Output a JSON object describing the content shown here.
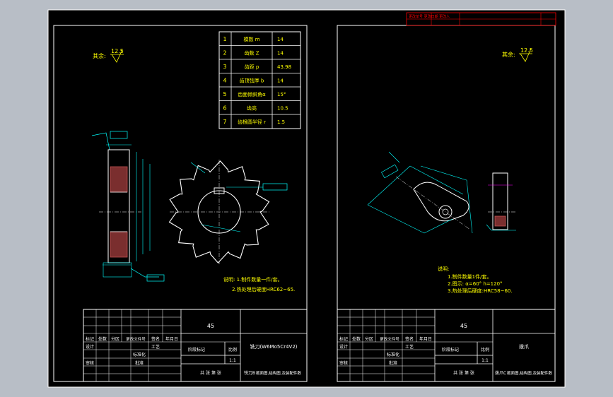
{
  "colors": {
    "background": "#000000",
    "frame": "#ffffff",
    "dimension": "#00ffff",
    "notes": "#ffff00",
    "header_red": "#ff0000",
    "hatch": "#c05050"
  },
  "left_sheet": {
    "roughness_label": "其余:",
    "roughness_value": "12.5",
    "param_table": [
      {
        "no": "1",
        "name": "模数 m",
        "value": "14"
      },
      {
        "no": "2",
        "name": "齿数 Z",
        "value": "14"
      },
      {
        "no": "3",
        "name": "齿距 p",
        "value": "43.98"
      },
      {
        "no": "4",
        "name": "齿顶弦厚 b",
        "value": "14"
      },
      {
        "no": "5",
        "name": "齿面倾斜角α",
        "value": "15°"
      },
      {
        "no": "6",
        "name": "齿高",
        "value": "10.5"
      },
      {
        "no": "7",
        "name": "齿根圆半径 r",
        "value": "1.5"
      }
    ],
    "notes": [
      "说明: 1.制件数量一件/套。",
      "2.热处理后硬度HRC62~65."
    ],
    "title_block": {
      "material": "45",
      "part_name": "铣刀(W6Mo5Cr4V2)",
      "revision_label": "标记",
      "count_label": "处数",
      "zone_label": "分区",
      "doc_label": "更改文件号",
      "sign_label": "签名",
      "date_label": "年月日",
      "design_label": "设计",
      "standard_label": "标准化",
      "process_label": "工艺",
      "check_label": "审核",
      "approve_label": "批准",
      "stage_label": "阶段标记",
      "weight_label": "重量",
      "scale_label": "比例",
      "scale_value": "1:1",
      "sheets_label": "共 张 第 张",
      "drawing_no": "铣刀B",
      "drawing_desc": "截面图,结构图,及装配件数"
    }
  },
  "right_sheet": {
    "header_text": "更改单号  更改日期  更改人",
    "roughness_label": "其余:",
    "roughness_value": "12.5",
    "notes": [
      "说明:",
      "1.制件数量1件/套。",
      "2.图示: α=60°  h=120°",
      "3.热处理后硬度:HRC58~60."
    ],
    "title_block": {
      "material": "45",
      "part_name": "拨爪",
      "revision_label": "标记",
      "count_label": "处数",
      "zone_label": "分区",
      "doc_label": "更改文件号",
      "sign_label": "签名",
      "date_label": "年月日",
      "design_label": "设计",
      "standard_label": "标准化",
      "process_label": "工艺",
      "check_label": "审核",
      "approve_label": "批准",
      "stage_label": "阶段标记",
      "weight_label": "重量",
      "scale_label": "比例",
      "scale_value": "1:1",
      "sheets_label": "共 张 第 张",
      "drawing_no": "拨爪C",
      "drawing_desc": "截面图,结构图,及装配件数"
    }
  }
}
